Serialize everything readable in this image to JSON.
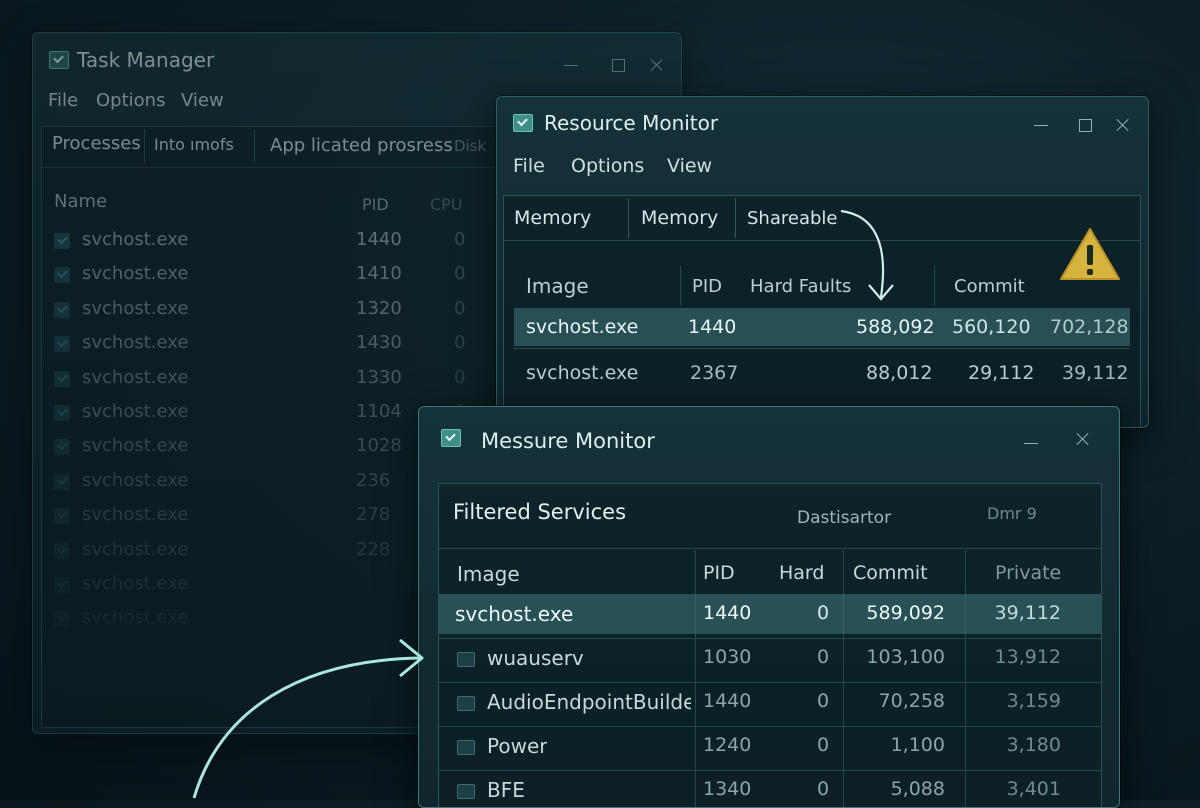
{
  "task_manager": {
    "title": "Task Manager",
    "menu": [
      "File",
      "Options",
      "View"
    ],
    "tabs": [
      "Processes",
      "Into ımofs",
      "App licated prosress",
      "Disk"
    ],
    "columns": [
      "Name",
      "PID",
      "CPU"
    ],
    "rows": [
      {
        "name": "svchost.exe",
        "pid": "1440",
        "cpu": "0"
      },
      {
        "name": "svchost.exe",
        "pid": "1410",
        "cpu": "0"
      },
      {
        "name": "svchost.exe",
        "pid": "1320",
        "cpu": "0"
      },
      {
        "name": "svchost.exe",
        "pid": "1430",
        "cpu": "0"
      },
      {
        "name": "svchost.exe",
        "pid": "1330",
        "cpu": "0"
      },
      {
        "name": "svchost.exe",
        "pid": "1104",
        "cpu": "0"
      },
      {
        "name": "svchost.exe",
        "pid": "1028",
        "cpu": "0"
      },
      {
        "name": "svchost.exe",
        "pid": "236",
        "cpu": "0"
      },
      {
        "name": "svchost.exe",
        "pid": "278",
        "cpu": "0"
      },
      {
        "name": "svchost.exe",
        "pid": "228",
        "cpu": "0"
      },
      {
        "name": "svchost.exe",
        "pid": "",
        "cpu": ""
      },
      {
        "name": "svchost.exe",
        "pid": "",
        "cpu": ""
      }
    ]
  },
  "resource_monitor": {
    "title": "Resource Monitor",
    "menu": [
      "File",
      "Options",
      "View"
    ],
    "tabs": [
      "Memory",
      "Memory",
      "Shareable"
    ],
    "columns": [
      "Image",
      "PID",
      "Hard Faults",
      "Commit"
    ],
    "rows": [
      {
        "image": "svchost.exe",
        "pid": "1440",
        "hard_faults": "588,092",
        "commit": "560,120",
        "extra": "702,128"
      },
      {
        "image": "svchost.exe",
        "pid": "2367",
        "hard_faults": "88,012",
        "commit": "29,112",
        "extra": "39,112"
      }
    ],
    "warning_icon": "warning-icon"
  },
  "messure_monitor": {
    "title": "Messure Monitor",
    "panel_title": "Filtered Services",
    "panel_subtitle": "Dastisartor",
    "panel_extra": "Dmr 9",
    "columns": [
      "Image",
      "PID",
      "Hard",
      "Commit",
      "Private"
    ],
    "rows": [
      {
        "image": "svchost.exe",
        "pid": "1440",
        "hard": "0",
        "commit": "589,092",
        "private": "39,112"
      },
      {
        "image": "wuauserv",
        "pid": "1030",
        "hard": "0",
        "commit": "103,100",
        "private": "13,912"
      },
      {
        "image": "AudioEndpointBuilde",
        "pid": "1440",
        "hard": "0",
        "commit": "70,258",
        "private": "3,159"
      },
      {
        "image": "Power",
        "pid": "1240",
        "hard": "0",
        "commit": "1,100",
        "private": "3,180"
      },
      {
        "image": "BFE",
        "pid": "1340",
        "hard": "0",
        "commit": "5,088",
        "private": "3,401"
      }
    ]
  },
  "colors": {
    "accent": "#7fd6c8",
    "warning": "#e8c248",
    "highlight_row": "#3f7a7b"
  }
}
